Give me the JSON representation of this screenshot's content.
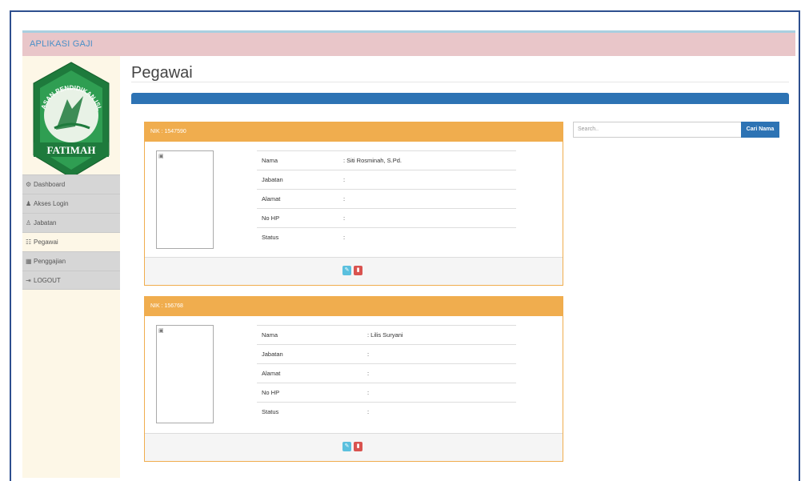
{
  "app": {
    "title": "APLIKASI GAJI"
  },
  "logo": {
    "arc_text": "YAYASAN PENDIDIKAN ISLAM",
    "name": "FATIMAH"
  },
  "sidebar": {
    "items": [
      {
        "label": "Dashboard",
        "icon": "dashboard-icon"
      },
      {
        "label": "Akses Login",
        "icon": "user-icon"
      },
      {
        "label": "Jabatan",
        "icon": "user-plus-icon"
      },
      {
        "label": "Pegawai",
        "icon": "users-icon",
        "active": true
      },
      {
        "label": "Penggajian",
        "icon": "calculator-icon"
      },
      {
        "label": "LOGOUT",
        "icon": "logout-icon"
      }
    ]
  },
  "page": {
    "title": "Pegawai"
  },
  "search": {
    "placeholder": "Search..",
    "button_label": "Cari Nama"
  },
  "field_labels": {
    "nama": "Nama",
    "jabatan": "Jabatan",
    "alamat": "Alamat",
    "no_hp": "No HP",
    "status": "Status"
  },
  "employees": [
    {
      "nik": "NIK : 1547590",
      "nama": ": Siti Rosminah, S.Pd.",
      "jabatan": ":",
      "alamat": ":",
      "no_hp": ":",
      "status": ":"
    },
    {
      "nik": "NIK : 156768",
      "nama": ": Lilis Suryani",
      "jabatan": ":",
      "alamat": ":",
      "no_hp": ":",
      "status": ":"
    }
  ],
  "colors": {
    "brand_bar": "#e9c6c9",
    "panel": "#2d73b4",
    "card_header": "#f0ad4e",
    "edit_button": "#5bc0de",
    "delete_button": "#d9534f"
  }
}
